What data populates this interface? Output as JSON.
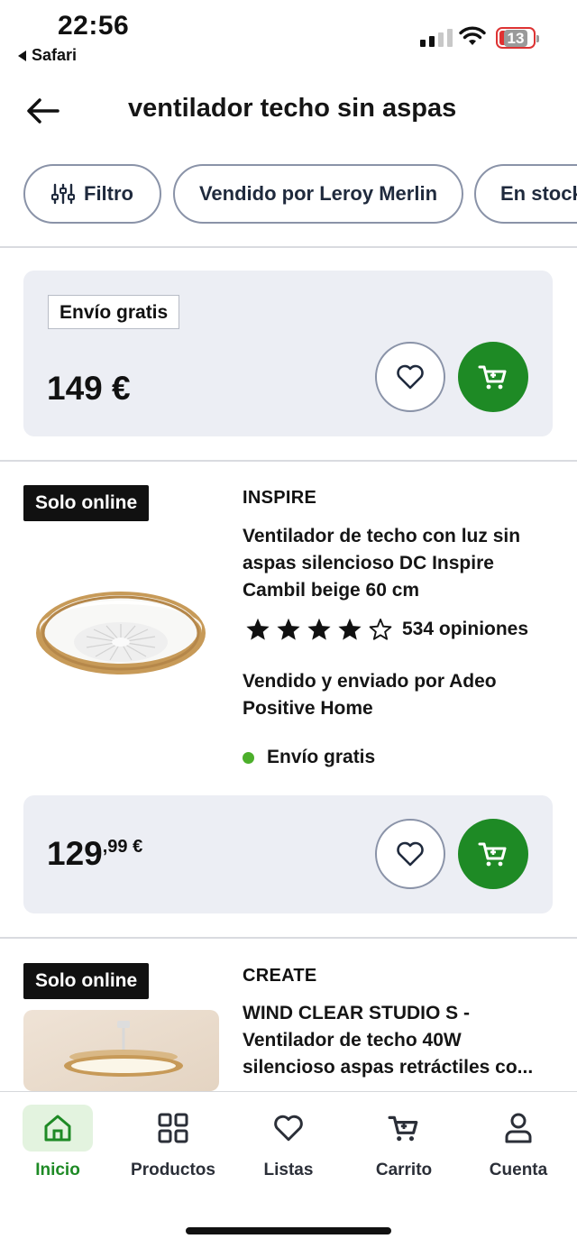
{
  "status_bar": {
    "time": "22:56",
    "back_app": "Safari",
    "battery": "13"
  },
  "header": {
    "title": "ventilador techo sin aspas"
  },
  "filters": [
    {
      "label": "Filtro"
    },
    {
      "label": "Vendido por Leroy Merlin"
    },
    {
      "label": "En stock"
    }
  ],
  "products": [
    {
      "badge": "Envío gratis",
      "price": "149 €"
    },
    {
      "tag": "Solo online",
      "brand": "INSPIRE",
      "title": "Ventilador de techo con luz sin aspas silencioso DC Inspire Cambil beige 60 cm",
      "rating": 4,
      "rating_max": 5,
      "reviews": "534 opiniones",
      "seller": "Vendido y enviado por Adeo Positive Home",
      "shipping": "Envío gratis",
      "price_int": "129",
      "price_dec": ",99 €"
    },
    {
      "tag": "Solo online",
      "brand": "CREATE",
      "title": "WIND CLEAR STUDIO S - Ventilador de techo 40W silencioso aspas retráctiles co..."
    }
  ],
  "colors": {
    "accent": "#1e8a25",
    "card_bg": "#eceef4",
    "shipping_dot": "#4caf2b"
  },
  "bottom_nav": [
    {
      "label": "Inicio",
      "icon": "home-icon",
      "active": true
    },
    {
      "label": "Productos",
      "icon": "grid-icon"
    },
    {
      "label": "Listas",
      "icon": "heart-icon"
    },
    {
      "label": "Carrito",
      "icon": "cart-icon"
    },
    {
      "label": "Cuenta",
      "icon": "user-icon"
    }
  ]
}
